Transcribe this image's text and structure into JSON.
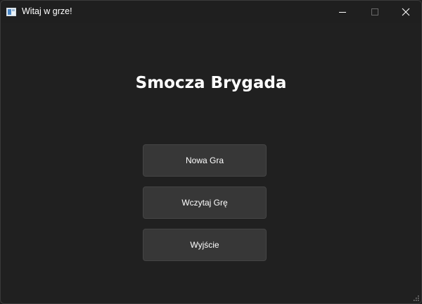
{
  "window": {
    "title": "Witaj w grze!",
    "icon": "app-window-icon",
    "controls": [
      "minimize-icon",
      "maximize-icon",
      "close-icon"
    ]
  },
  "main": {
    "game_title": "Smocza Brygada",
    "buttons": {
      "new_game": "Nowa Gra",
      "load_game": "Wczytaj Grę",
      "exit": "Wyjście"
    }
  },
  "colors": {
    "background": "#202020",
    "button": "#373737",
    "button_border": "#444444",
    "text": "#ffffff"
  }
}
